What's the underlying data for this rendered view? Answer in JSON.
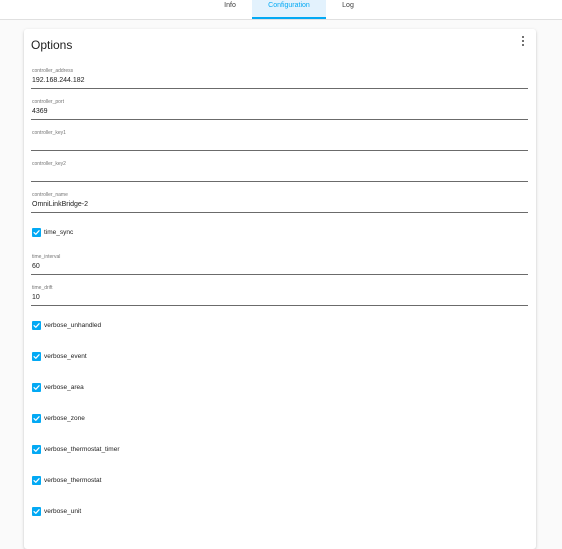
{
  "tabs": [
    {
      "label": "Info",
      "active": false
    },
    {
      "label": "Configuration",
      "active": true
    },
    {
      "label": "Log",
      "active": false
    }
  ],
  "colors": {
    "accent": "#03a9f4",
    "active_tab_background": "#e3f2fd"
  },
  "card": {
    "title": "Options",
    "menu_icon": "dots-vertical-icon"
  },
  "fields": {
    "controller_address": {
      "label": "controller_address",
      "value": "192.168.244.182"
    },
    "controller_port": {
      "label": "controller_port",
      "value": "4369"
    },
    "controller_key1": {
      "label": "controller_key1",
      "value": ""
    },
    "controller_key2": {
      "label": "controller_key2",
      "value": ""
    },
    "controller_name": {
      "label": "controller_name",
      "value": "OmniLinkBridge-2"
    },
    "time_interval": {
      "label": "time_interval",
      "value": "60"
    },
    "time_drift": {
      "label": "time_drift",
      "value": "10"
    }
  },
  "checkboxes": {
    "time_sync": {
      "label": "time_sync",
      "checked": true
    },
    "verbose_unhandled": {
      "label": "verbose_unhandled",
      "checked": true
    },
    "verbose_event": {
      "label": "verbose_event",
      "checked": true
    },
    "verbose_area": {
      "label": "verbose_area",
      "checked": true
    },
    "verbose_zone": {
      "label": "verbose_zone",
      "checked": true
    },
    "verbose_thermostat_timer": {
      "label": "verbose_thermostat_timer",
      "checked": true
    },
    "verbose_thermostat": {
      "label": "verbose_thermostat",
      "checked": true
    },
    "verbose_unit": {
      "label": "verbose_unit",
      "checked": true
    }
  }
}
